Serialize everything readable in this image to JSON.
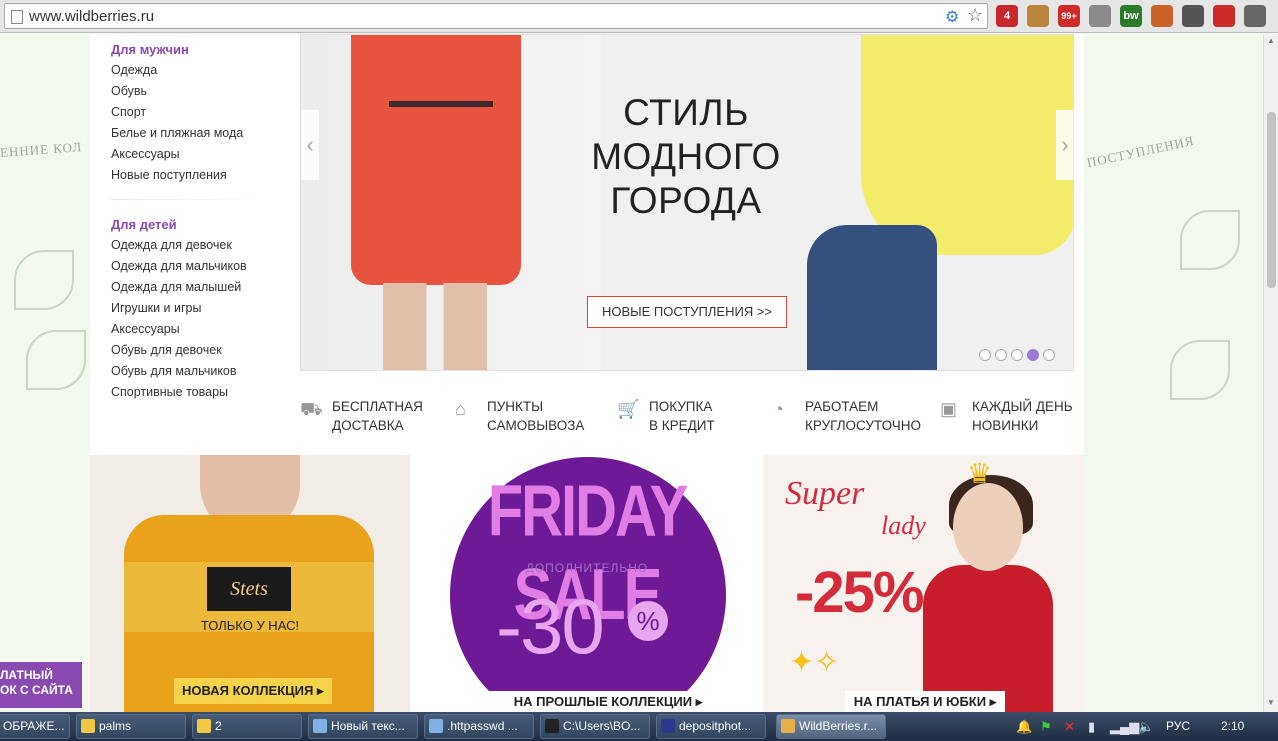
{
  "browser": {
    "url": "www.wildberries.ru",
    "extensions": [
      {
        "name": "adblock-icon",
        "badge": "4",
        "color": "#c8262a"
      },
      {
        "name": "cookie-icon",
        "badge": "",
        "color": "#b8863b"
      },
      {
        "name": "mail-icon",
        "badge": "99+",
        "color": "#d02b2b"
      },
      {
        "name": "globe-icon",
        "badge": "",
        "color": "#8a8a8a"
      },
      {
        "name": "bw-icon",
        "badge": "bw",
        "color": "#2d7a2d"
      },
      {
        "name": "hammer-icon",
        "badge": "",
        "color": "#c9632a"
      },
      {
        "name": "eyedropper-icon",
        "badge": "",
        "color": "#555555"
      },
      {
        "name": "power-icon",
        "badge": "",
        "color": "#cc2a2a"
      },
      {
        "name": "menu-icon",
        "badge": "",
        "color": "#666666"
      }
    ]
  },
  "deco": {
    "left_text": "ЕННИЕ КОЛ",
    "right_text": "ПОСТУПЛЕНИЯ"
  },
  "sidebar": {
    "men_title": "Для мужчин",
    "men_links": [
      "Одежда",
      "Обувь",
      "Спорт",
      "Белье и пляжная мода",
      "Аксессуары",
      "Новые поступления"
    ],
    "kids_title": "Для детей",
    "kids_links": [
      "Одежда для девочек",
      "Одежда для мальчиков",
      "Одежда для малышей",
      "Игрушки и игры",
      "Аксессуары",
      "Обувь для девочек",
      "Обувь для мальчиков",
      "Спортивные товары"
    ]
  },
  "hero": {
    "title_line1": "СТИЛЬ",
    "title_line2": "МОДНОГО",
    "title_line3": "ГОРОДА",
    "cta": "НОВЫЕ ПОСТУПЛЕНИЯ >>",
    "prev_arrow": "‹",
    "next_arrow": "›",
    "slides_total": 5,
    "active_slide": 4
  },
  "features": [
    {
      "icon": "truck-icon",
      "line1": "БЕСПЛАТНАЯ",
      "line2": "ДОСТАВКА"
    },
    {
      "icon": "pickup-house-icon",
      "line1": "ПУНКТЫ",
      "line2": "САМОВЫВОЗА"
    },
    {
      "icon": "cart-icon",
      "line1": "ПОКУПКА",
      "line2": "В КРЕДИТ"
    },
    {
      "icon": "clock-24-7-icon",
      "line1": "РАБОТАЕМ",
      "line2": "КРУГЛОСУТОЧНО"
    },
    {
      "icon": "new-box-icon",
      "line1": "КАЖДЫЙ ДЕНЬ",
      "line2": "НОВИНКИ"
    }
  ],
  "promos": {
    "stets": {
      "logo": "Stets",
      "tagline": "ТОЛЬКО  У НАС!",
      "label": "НОВАЯ КОЛЛЕКЦИЯ"
    },
    "friday": {
      "headline": "FRIDAY SALE",
      "extra": "ДОПОЛНИТЕЛЬНО",
      "discount": "-30",
      "percent": "%",
      "label": "НА ПРОШЛЫЕ КОЛЛЕКЦИИ"
    },
    "superlady": {
      "super": "Super",
      "lady": "lady",
      "discount": "-25%",
      "label": "НА ПЛАТЬЯ И ЮБКИ"
    }
  },
  "callback": {
    "line1": "ЛАТНЫЙ",
    "line2": "ОК С САЙТА"
  },
  "taskbar": {
    "items": [
      {
        "label": "ОБРАЖЕ...",
        "icon_color": "#b5b5b5"
      },
      {
        "label": "palms",
        "icon_color": "#f0c846"
      },
      {
        "label": "2",
        "icon_color": "#f0c846"
      },
      {
        "label": "Новый текс...",
        "icon_color": "#7fb0e6"
      },
      {
        "label": ".httpasswd ...",
        "icon_color": "#7fb0e6"
      },
      {
        "label": "C:\\Users\\BO...",
        "icon_color": "#222222"
      },
      {
        "label": "depositphot...",
        "icon_color": "#2a3a8a"
      },
      {
        "label": "WildBerries.r...",
        "icon_color": "#e8b04a"
      }
    ],
    "language": "РУС",
    "time": "2:10"
  }
}
